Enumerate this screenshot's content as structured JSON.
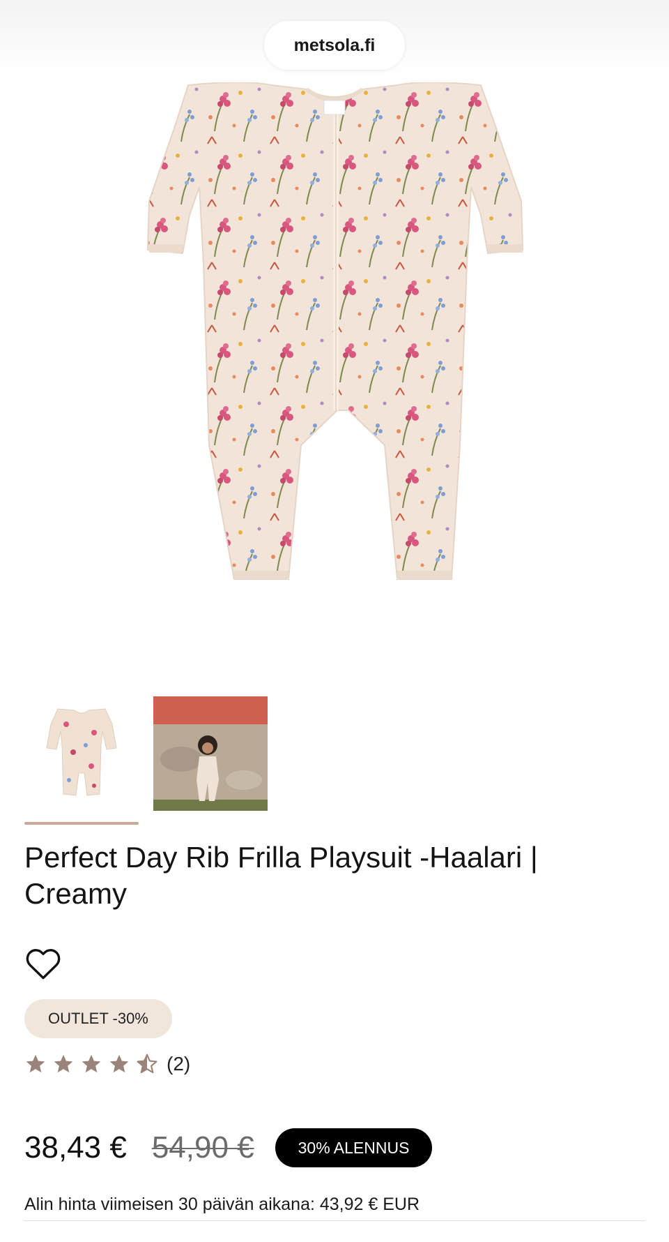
{
  "browser": {
    "url": "metsola.fi"
  },
  "product": {
    "title": "Perfect Day Rib Frilla Playsuit -Haalari | Creamy",
    "badge": "OUTLET -30%",
    "rating": 4.5,
    "review_count": "(2)",
    "price_current": "38,43 €",
    "price_original": "54,90 €",
    "discount_label": "30% ALENNUS",
    "lowest_price_note": "Alin hinta viimeisen 30 päivän aikana: 43,92 € EUR",
    "images": {
      "main_alt": "playsuit-product-photo",
      "thumbs": [
        "product-thumbnail",
        "lifestyle-thumbnail"
      ],
      "selected_thumb": 0
    }
  },
  "colors": {
    "fabric": "#f2e4d8",
    "accent_pink": "#d9577f",
    "accent_blue": "#7e9ed3",
    "leaf": "#7d8a4e",
    "star": "#9a8378",
    "badge_bg": "#f1e6dc",
    "thumb_underline": "#c9a995"
  },
  "icons": {
    "wishlist": "heart-outline-icon",
    "star": "star-icon"
  }
}
